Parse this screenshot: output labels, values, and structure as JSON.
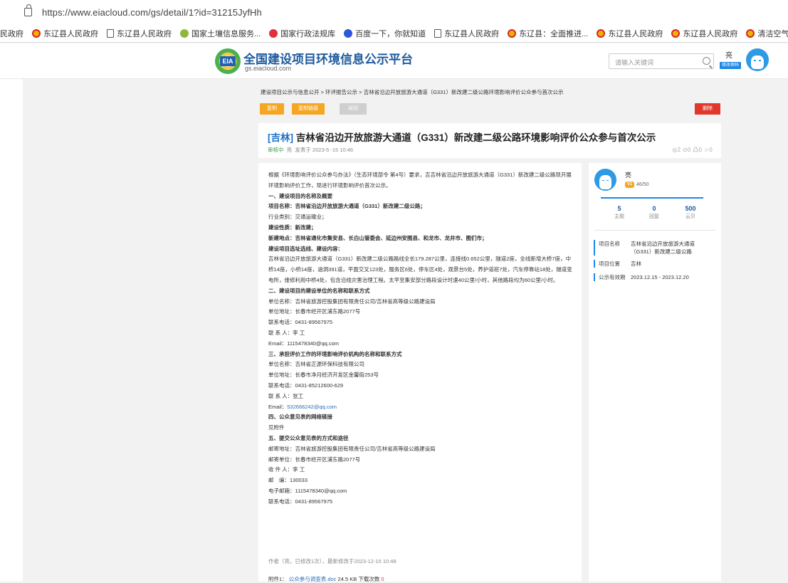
{
  "browser": {
    "url": "https://www.eiacloud.com/gs/detail/1?id=31215JyfHh"
  },
  "bookmarks": [
    {
      "label": "民政府",
      "icon": "none"
    },
    {
      "label": "东辽县人民政府",
      "icon": "gov-emblem-icon"
    },
    {
      "label": "东辽县人民政府",
      "icon": "page-icon"
    },
    {
      "label": "国家土壤信息服务...",
      "icon": "soil-icon"
    },
    {
      "label": "国家行政法规库",
      "icon": "law-icon"
    },
    {
      "label": "百度一下，你就知道",
      "icon": "baidu-icon"
    },
    {
      "label": "东辽县人民政府",
      "icon": "page-icon"
    },
    {
      "label": "东辽县：全面推进...",
      "icon": "gov-emblem-icon"
    },
    {
      "label": "东辽县人民政府",
      "icon": "gov-emblem-icon"
    },
    {
      "label": "东辽县人民政府",
      "icon": "gov-emblem-icon"
    },
    {
      "label": "清洁空气行动计划",
      "icon": "gov-emblem-icon"
    }
  ],
  "header": {
    "logo_text": "EIA",
    "site_title": "全国建设项目环境信息公示平台",
    "site_sub": "gs.eiacloud.com",
    "search_placeholder": "请输入关键词",
    "user_name": "亮",
    "edit_password": "修改密码"
  },
  "breadcrumb": "建设项目公示与信息公开 > 环评报告公示 > 吉林省沿边开放旅游大通道（G331）新改建二级公路环境影响评价公众参与首次公示",
  "buttons": {
    "copy": "复制",
    "copy_link": "复制链接",
    "back": "返回",
    "delete": "删除"
  },
  "article": {
    "region_tag": "[吉林]",
    "title": "吉林省沿边开放旅游大通道（G331）新改建二级公路环境影响评价公众参与首次公示",
    "status": "审核中",
    "author": "亮",
    "published": "发表于 2023-5 -15 10:46",
    "stats": "◎2  ⊙0  凸0  ☆0",
    "body": [
      {
        "t": "根据《环境影响评价公众参与办法》（生态环境部令 第4号）要求，吉吉林省沿边开放旅游大通道（G331）新改建二级公路现开展环境影响评价工作，现进行环境影响评价首次公示。",
        "s": "p"
      },
      {
        "t": "一、建设项目的名称及概要",
        "s": "h"
      },
      {
        "t": "项目名称：吉林省沿边开放旅游大通道（G331）新改建二级公路；",
        "s": "h"
      },
      {
        "t": "行业类别：交通运输业；",
        "s": "p"
      },
      {
        "t": "建设性质：新改建；",
        "s": "h"
      },
      {
        "t": "新建地点：吉林省通化市集安县、长白山管委会、延边州安图县、和龙市、龙井市、图们市；",
        "s": "h"
      },
      {
        "t": "建设项目选址选线、建设内容：",
        "s": "h"
      },
      {
        "t": "吉林省沿边开放旅游大通道（G331）新改建二级公路路线全长179.287公里，连接线0.652公里，隧道2座，全线新增大桥7座，中桥14座，小桥14座，涵洞391道，平面交叉123处，服务区6处，停车区4处，观景台5处，养护道班7处，汽车停靠站18处，隧道变电所，维修利用中桥4处，包含沿线灾害治理工程。太平至集安部分路段设计时速40公里/小时，其他路段均为60公里/小时。",
        "s": "p"
      },
      {
        "t": "二、建设项目的建设单位的名称和联系方式",
        "s": "h"
      },
      {
        "t": "单位名称：吉林省旅游控股集团有限责任公司/吉林省高等级公路建设局",
        "s": "p"
      },
      {
        "t": "单位地址：长春市经开区浦东路2077号",
        "s": "p"
      },
      {
        "t": "联系电话：0431-89567975",
        "s": "p"
      },
      {
        "t": "联 系 人：李 工",
        "s": "p"
      },
      {
        "t": "Email：1115478340@qq.com",
        "s": "p"
      },
      {
        "t": "三、承担评价工作的环境影响评价机构的名称和联系方式",
        "s": "h"
      },
      {
        "t": "单位名称：吉林省正源环保科技有限公司",
        "s": "p"
      },
      {
        "t": "单位地址：长春市净月经济开发区金馨街253号",
        "s": "p"
      },
      {
        "t": "联系电话：0431-85212600-629",
        "s": "p"
      },
      {
        "t": "联 系 人：张工",
        "s": "p"
      },
      {
        "t": "Email：532666242@qq.com",
        "s": "e"
      },
      {
        "t": "四、公众意见表的网络链接",
        "s": "h"
      },
      {
        "t": "见附件",
        "s": "p"
      },
      {
        "t": "五、提交公众意见表的方式和途径",
        "s": "h"
      },
      {
        "t": "邮寄地址：吉林省旅游控股集团有限责任公司/吉林省高等级公路建设局",
        "s": "p"
      },
      {
        "t": "邮寄单位：长春市经开区浦东路2077号",
        "s": "p"
      },
      {
        "t": "收 件 人：李 工",
        "s": "p"
      },
      {
        "t": "邮　编：130033",
        "s": "p"
      },
      {
        "t": "电子邮箱：1115478340@qq.com",
        "s": "p"
      },
      {
        "t": "联系电话：0431-89567975",
        "s": "p"
      }
    ],
    "edit_info": "作者（亮，已修改1次），最新修改于2023-12-15 10:48",
    "attachment": {
      "prefix": "附件1：",
      "name": "公众参与调查表.doc",
      "size": "24.5 KB",
      "downloads_label": "下载次数",
      "downloads": "0"
    }
  },
  "sidebar": {
    "name": "亮",
    "level_badge": "V1",
    "level_progress": "46/50",
    "stats": [
      {
        "n": "5",
        "l": "主题"
      },
      {
        "n": "0",
        "l": "回复"
      },
      {
        "n": "500",
        "l": "云贝"
      }
    ],
    "info": [
      {
        "k": "项目名称",
        "v": "吉林省沿边开放旅游大通道（G331）新改建二级公路"
      },
      {
        "k": "项目位置",
        "v": "吉林"
      },
      {
        "k": "公示有效期",
        "v": "2023.12.15 - 2023.12.20"
      }
    ]
  }
}
